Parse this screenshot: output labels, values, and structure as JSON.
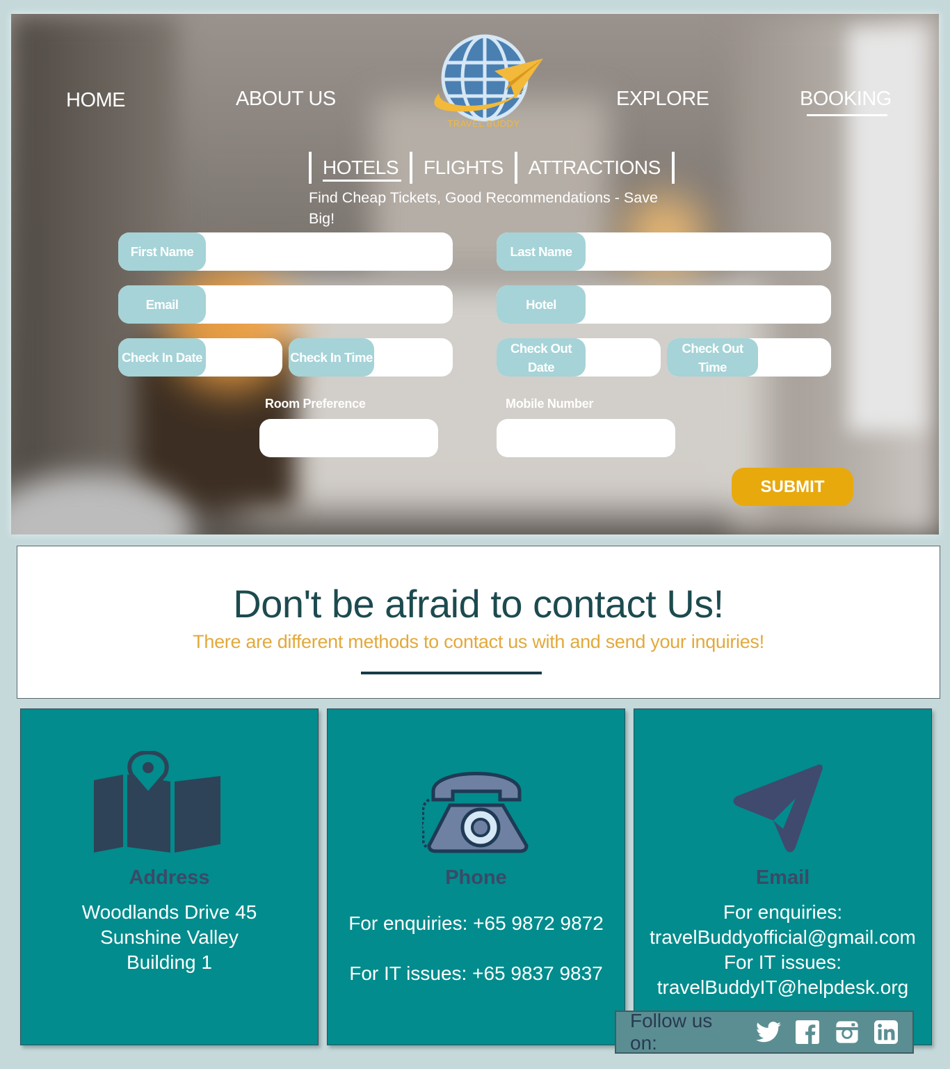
{
  "nav": {
    "home": "HOME",
    "about": "ABOUT US",
    "explore": "EXPLORE",
    "booking": "BOOKING",
    "logo_text": "TRAVEL BUDDY"
  },
  "subnav": {
    "hotels": "HOTELS",
    "flights": "FLIGHTS",
    "attractions": "ATTRACTIONS"
  },
  "tagline": "Find Cheap Tickets, Good Recommendations - Save Big!",
  "form": {
    "first_name": "First Name",
    "last_name": "Last Name",
    "email": "Email",
    "hotel": "Hotel",
    "check_in_date": "Check In Date",
    "check_in_time": "Check In Time",
    "check_out_date": "Check Out Date",
    "check_out_time": "Check Out Time",
    "room_preference": "Room Preference",
    "mobile_number": "Mobile Number",
    "submit": "SUBMIT"
  },
  "contact": {
    "title": "Don't be afraid to contact Us!",
    "subtitle": "There are different methods to contact us with and send your inquiries!"
  },
  "cards": {
    "address": {
      "title": "Address",
      "line1": "Woodlands Drive 45",
      "line2": "Sunshine Valley",
      "line3": "Building 1"
    },
    "phone": {
      "title": "Phone",
      "enquiries": "For enquiries: +65 9872 9872",
      "it": "For IT issues: +65 9837 9837"
    },
    "email": {
      "title": "Email",
      "enquiries_label": "For enquiries:",
      "enquiries_email": "travelBuddyofficial@gmail.com",
      "it_label": "For IT issues:",
      "it_email": "travelBuddyIT@helpdesk.org"
    }
  },
  "follow": {
    "label": "Follow us on:",
    "icons": [
      "twitter-icon",
      "facebook-icon",
      "instagram-icon",
      "linkedin-icon"
    ]
  },
  "colors": {
    "teal": "#028c8d",
    "field_label": "#a5d3d7",
    "submit": "#e8a90d",
    "heading": "#1c4a4f",
    "accent_gold": "#e2a93b"
  }
}
